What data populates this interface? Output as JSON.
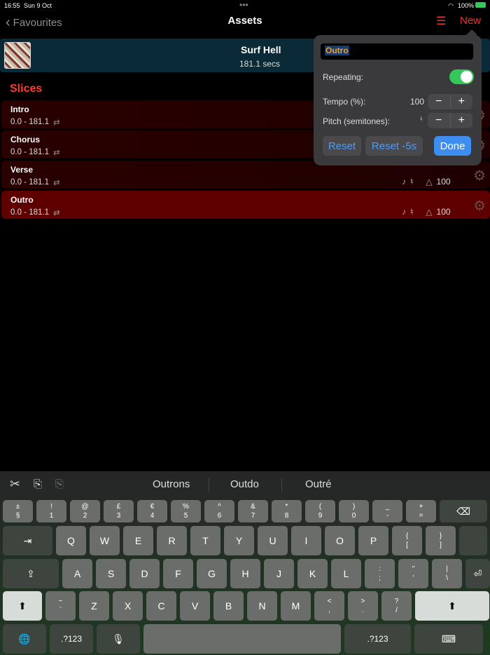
{
  "status": {
    "time": "16:55",
    "date": "Sun 9 Oct",
    "battery": "100%"
  },
  "nav": {
    "back": "Favourites",
    "title": "Assets",
    "new": "New"
  },
  "asset": {
    "title": "Surf Hell",
    "duration": "181.1 secs"
  },
  "slices_heading": "Slices",
  "slices": [
    {
      "name": "Intro",
      "range": "0.0 - 181.1"
    },
    {
      "name": "Chorus",
      "range": "0.0 - 181.1"
    },
    {
      "name": "Verse",
      "range": "0.0 - 181.1",
      "pitch": "♮",
      "tempo": "100"
    },
    {
      "name": "Outro",
      "range": "0.0 - 181.1",
      "pitch": "♮",
      "tempo": "100",
      "selected": true
    }
  ],
  "popover": {
    "name_value": "Outro",
    "repeating_label": "Repeating:",
    "repeating": true,
    "tempo_label": "Tempo (%):",
    "tempo_value": "100",
    "pitch_label": "Pitch (semitones):",
    "pitch_value": "♮",
    "minus": "−",
    "plus": "+",
    "reset": "Reset",
    "reset5": "Reset -5s",
    "done": "Done"
  },
  "keyboard": {
    "suggestions": [
      "Outrons",
      "Outdo",
      "Outré"
    ],
    "row1": [
      [
        "±",
        "§"
      ],
      [
        "!",
        "1"
      ],
      [
        "@",
        "2"
      ],
      [
        "£",
        "3"
      ],
      [
        "€",
        "4"
      ],
      [
        "%",
        "5"
      ],
      [
        "^",
        "6"
      ],
      [
        "&",
        "7"
      ],
      [
        "*",
        "8"
      ],
      [
        "(",
        "9"
      ],
      [
        ")",
        "0"
      ],
      [
        "_",
        "-"
      ],
      [
        "+",
        "="
      ]
    ],
    "row2": [
      "Q",
      "W",
      "E",
      "R",
      "T",
      "Y",
      "U",
      "I",
      "O",
      "P"
    ],
    "row2b": [
      [
        "{",
        "["
      ],
      [
        "}",
        "]"
      ]
    ],
    "row3": [
      "A",
      "S",
      "D",
      "F",
      "G",
      "H",
      "J",
      "K",
      "L"
    ],
    "row3b": [
      [
        ":",
        ";"
      ],
      [
        "\"",
        "'"
      ],
      [
        "|",
        "\\"
      ]
    ],
    "row4a": [
      [
        "~",
        "`"
      ]
    ],
    "row4": [
      "Z",
      "X",
      "C",
      "V",
      "B",
      "N",
      "M"
    ],
    "row4b": [
      [
        "<",
        ","
      ],
      [
        ">",
        "."
      ],
      [
        "?",
        "/"
      ]
    ],
    "numbers": ".?123"
  }
}
